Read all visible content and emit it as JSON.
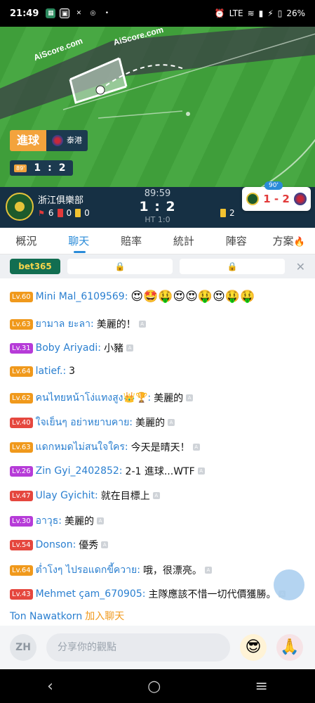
{
  "status_bar": {
    "time": "21:49",
    "battery": "26%",
    "network": "LTE"
  },
  "video": {
    "watermark_1": "AiScore.com",
    "watermark_2": "AiScore.com",
    "goal_label": "進球",
    "goal_team": "泰港",
    "mini_minute": "89'",
    "mini_home": "1",
    "mini_sep": ":",
    "mini_away": "2"
  },
  "match": {
    "home_team": "浙江俱樂部",
    "clock": "89:59",
    "score": "1 : 2",
    "halftime": "HT 1:0",
    "home_corners": "6",
    "home_reds": "0",
    "home_yellows": "0",
    "away_yellows": "2",
    "float_minute": "90'",
    "float_score": "1 - 2"
  },
  "tabs": [
    "概況",
    "聊天",
    "賠率",
    "統計",
    "陣容",
    "方案"
  ],
  "ad_bar": {
    "sponsor": "bet365",
    "lock_icon": "lock-icon"
  },
  "chat": [
    {
      "level": "Lv.60",
      "name": "Mini Mal_6109569:",
      "msg": "😍🤩🤑😍😍🤑😍🤑🤑",
      "lvclass": "o"
    },
    {
      "level": "Lv.63",
      "name": "ยามาล ยะลา:",
      "msg": "美麗的！",
      "lvclass": "o"
    },
    {
      "level": "Lv.31",
      "name": "Boby Ariyadi:",
      "msg": "小豬",
      "lvclass": "p"
    },
    {
      "level": "Lv.64",
      "name": "latief.:",
      "msg": "3",
      "lvclass": "o"
    },
    {
      "level": "Lv.62",
      "name": "คนไทยหน้าโง่แทงสูง👑🏆:",
      "msg": "美麗的",
      "lvclass": "o"
    },
    {
      "level": "Lv.40",
      "name": "ใจเย็นๆ อย่าหยาบคาย:",
      "msg": "美麗的",
      "lvclass": "r"
    },
    {
      "level": "Lv.63",
      "name": "แดกหมดไม่สนใจใคร:",
      "msg": "今天是晴天！",
      "lvclass": "o"
    },
    {
      "level": "Lv.26",
      "name": "Zin Gyi_2402852:",
      "msg": "2-1 進球...WTF",
      "lvclass": "p"
    },
    {
      "level": "Lv.47",
      "name": "Ulay Gyichit:",
      "msg": "就在目標上",
      "lvclass": "r"
    },
    {
      "level": "Lv.30",
      "name": "อาวุธ:",
      "msg": "美麗的",
      "lvclass": "p"
    },
    {
      "level": "Lv.54",
      "name": "Donson:",
      "msg": "優秀",
      "lvclass": "r"
    },
    {
      "level": "Lv.64",
      "name": "ต่ำโงๆ ไปรอแดกขี้ควาย:",
      "msg": "哦，很漂亮。",
      "lvclass": "o"
    },
    {
      "level": "Lv.43",
      "name": "Mehmet çam_670905:",
      "msg": "主隊應該不惜一切代價獲勝。",
      "lvclass": "r"
    }
  ],
  "join_notice": {
    "name": "Ton Nawatkorn",
    "action": "加入聊天"
  },
  "input": {
    "avatar": "ZH",
    "placeholder": "分享你的觀點"
  }
}
